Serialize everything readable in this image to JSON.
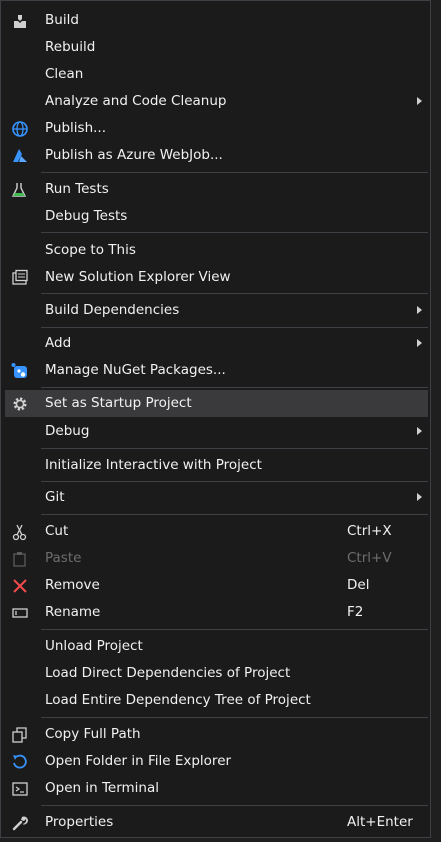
{
  "menu": {
    "build": "Build",
    "rebuild": "Rebuild",
    "clean": "Clean",
    "analyze": "Analyze and Code Cleanup",
    "publish": "Publish...",
    "publish_webjob": "Publish as Azure WebJob...",
    "run_tests": "Run Tests",
    "debug_tests": "Debug Tests",
    "scope": "Scope to This",
    "new_view": "New Solution Explorer View",
    "build_deps": "Build Dependencies",
    "add": "Add",
    "nuget": "Manage NuGet Packages...",
    "startup": "Set as Startup Project",
    "debug": "Debug",
    "interactive": "Initialize Interactive with Project",
    "git": "Git",
    "cut": "Cut",
    "cut_shortcut": "Ctrl+X",
    "paste": "Paste",
    "paste_shortcut": "Ctrl+V",
    "remove": "Remove",
    "remove_shortcut": "Del",
    "rename": "Rename",
    "rename_shortcut": "F2",
    "unload": "Unload Project",
    "load_direct": "Load Direct Dependencies of Project",
    "load_entire": "Load Entire Dependency Tree of Project",
    "copy_path": "Copy Full Path",
    "open_folder": "Open Folder in File Explorer",
    "open_terminal": "Open in Terminal",
    "properties": "Properties",
    "properties_shortcut": "Alt+Enter"
  },
  "colors": {
    "background": "#1b1b1c",
    "text": "#f1f1f1",
    "disabled_text": "#6d6d6d",
    "highlight": "#3a3a3c",
    "accent_blue": "#3794ff",
    "remove_red": "#f14c4c"
  }
}
